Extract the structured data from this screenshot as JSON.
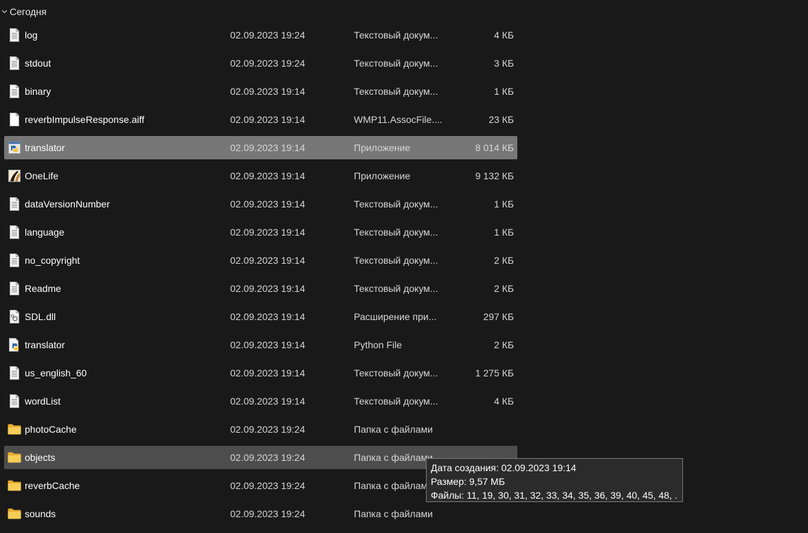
{
  "group": {
    "label": "Сегодня"
  },
  "files": [
    {
      "name": "log",
      "date": "02.09.2023 19:24",
      "type": "Текстовый докум...",
      "size": "4 КБ",
      "icon": "text-file-icon",
      "state": ""
    },
    {
      "name": "stdout",
      "date": "02.09.2023 19:24",
      "type": "Текстовый докум...",
      "size": "3 КБ",
      "icon": "text-file-icon",
      "state": ""
    },
    {
      "name": "binary",
      "date": "02.09.2023 19:14",
      "type": "Текстовый докум...",
      "size": "1 КБ",
      "icon": "text-file-icon",
      "state": ""
    },
    {
      "name": "reverbImpulseResponse.aiff",
      "date": "02.09.2023 19:14",
      "type": "WMP11.AssocFile....",
      "size": "23 КБ",
      "icon": "blank-file-icon",
      "state": ""
    },
    {
      "name": "translator",
      "date": "02.09.2023 19:14",
      "type": "Приложение",
      "size": "8 014 КБ",
      "icon": "python-exe-icon",
      "state": "selected"
    },
    {
      "name": "OneLife",
      "date": "02.09.2023 19:14",
      "type": "Приложение",
      "size": "9 132 КБ",
      "icon": "onelife-app-icon",
      "state": ""
    },
    {
      "name": "dataVersionNumber",
      "date": "02.09.2023 19:14",
      "type": "Текстовый докум...",
      "size": "1 КБ",
      "icon": "text-file-icon",
      "state": ""
    },
    {
      "name": "language",
      "date": "02.09.2023 19:14",
      "type": "Текстовый докум...",
      "size": "1 КБ",
      "icon": "text-file-icon",
      "state": ""
    },
    {
      "name": "no_copyright",
      "date": "02.09.2023 19:14",
      "type": "Текстовый докум...",
      "size": "2 КБ",
      "icon": "text-file-icon",
      "state": ""
    },
    {
      "name": "Readme",
      "date": "02.09.2023 19:14",
      "type": "Текстовый докум...",
      "size": "2 КБ",
      "icon": "text-file-icon",
      "state": ""
    },
    {
      "name": "SDL.dll",
      "date": "02.09.2023 19:14",
      "type": "Расширение при...",
      "size": "297 КБ",
      "icon": "dll-file-icon",
      "state": ""
    },
    {
      "name": "translator",
      "date": "02.09.2023 19:14",
      "type": "Python File",
      "size": "2 КБ",
      "icon": "python-file-icon",
      "state": ""
    },
    {
      "name": "us_english_60",
      "date": "02.09.2023 19:14",
      "type": "Текстовый докум...",
      "size": "1 275 КБ",
      "icon": "text-file-icon",
      "state": ""
    },
    {
      "name": "wordList",
      "date": "02.09.2023 19:14",
      "type": "Текстовый докум...",
      "size": "4 КБ",
      "icon": "text-file-icon",
      "state": ""
    },
    {
      "name": "photoCache",
      "date": "02.09.2023 19:24",
      "type": "Папка с файлами",
      "size": "",
      "icon": "folder-icon",
      "state": ""
    },
    {
      "name": "objects",
      "date": "02.09.2023 19:24",
      "type": "Папка с файлами",
      "size": "",
      "icon": "folder-icon",
      "state": "hover"
    },
    {
      "name": "reverbCache",
      "date": "02.09.2023 19:24",
      "type": "Папка с файлами",
      "size": "",
      "icon": "folder-icon",
      "state": ""
    },
    {
      "name": "sounds",
      "date": "02.09.2023 19:24",
      "type": "Папка с файлами",
      "size": "",
      "icon": "folder-icon",
      "state": ""
    }
  ],
  "tooltip": {
    "created": "Дата создания: 02.09.2023 19:14",
    "size": "Размер: 9,57 МБ",
    "files": "Файлы: 11, 19, 30, 31, 32, 33, 34, 35, 36, 39, 40, 45, 48, ..."
  },
  "colors": {
    "background": "#191919",
    "selected": "#777777",
    "hover": "#4d4d4d",
    "folder": "#f5c84a"
  }
}
